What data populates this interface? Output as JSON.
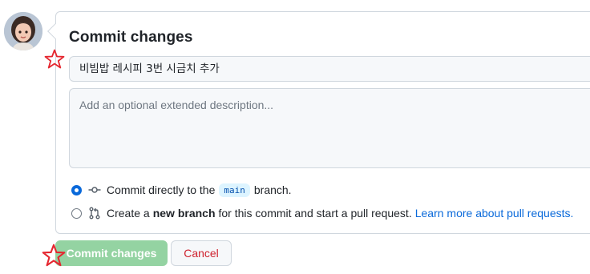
{
  "user": {
    "avatar_icon": "memoji-avatar-icon"
  },
  "commit_panel": {
    "title": "Commit changes",
    "summary_value": "비빔밥 레시피 3번 시금치 추가",
    "description_placeholder": "Add an optional extended description...",
    "option_direct": {
      "prefix": "Commit directly to the",
      "branch": "main",
      "suffix": "branch.",
      "icon": "git-commit-icon",
      "selected": true
    },
    "option_new_branch": {
      "prefix": "Create a",
      "bold": "new branch",
      "middle": "for this commit and start a pull request.",
      "link": "Learn more about pull requests.",
      "icon": "git-pull-request-icon",
      "selected": false
    }
  },
  "actions": {
    "commit_label": "Commit changes",
    "cancel_label": "Cancel"
  },
  "annotations": {
    "marker_icon": "red-star-outline-icon",
    "marker_color": "#e5262f"
  },
  "colors": {
    "accent": "#0969da",
    "commit_button_disabled": "#94d3a2",
    "cancel_text": "#cf222e",
    "branch_pill_bg": "#ddf4ff"
  }
}
